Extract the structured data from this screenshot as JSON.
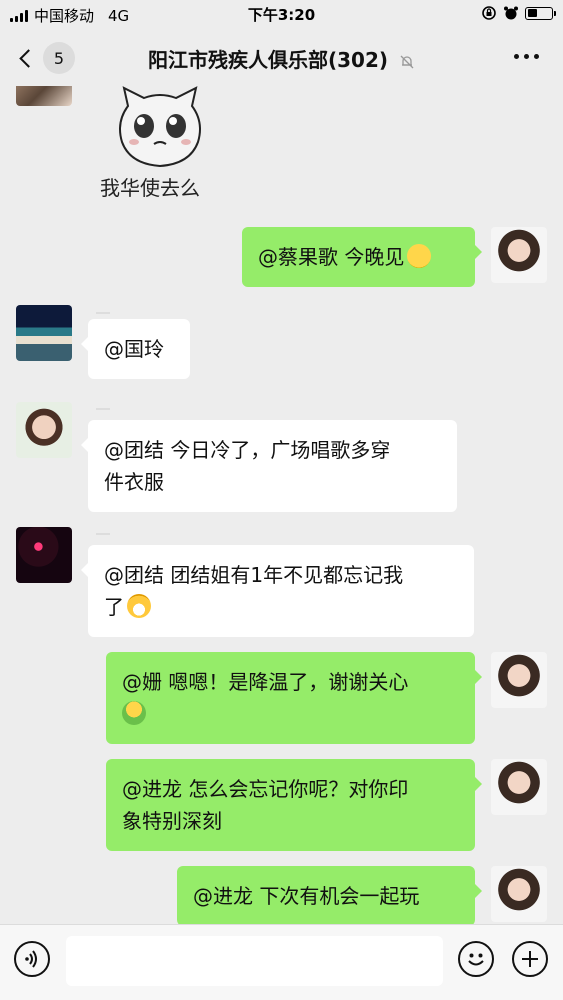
{
  "status_bar": {
    "carrier": "中国移动",
    "network": "4G",
    "time": "下午3:20"
  },
  "nav": {
    "back_count": "5",
    "title": "阳江市残疾人俱乐部(302)"
  },
  "sticker_caption": "我华使去么",
  "messages": [
    {
      "side": "out",
      "text": "@蔡果歌 今晚见"
    },
    {
      "side": "in",
      "text": "@国玲"
    },
    {
      "side": "in",
      "text_line1": "@团结 今日冷了，广场唱歌多穿",
      "text_line2": "件衣服"
    },
    {
      "side": "in",
      "text_line1": "@团结 团结姐有1年不见都忘记我",
      "text_line2": "了"
    },
    {
      "side": "out",
      "text_line1": "@姗 嗯嗯！是降温了，谢谢关心",
      "text_line2": ""
    },
    {
      "side": "out",
      "text_line1": "@进龙 怎么会忘记你呢？对你印",
      "text_line2": "象特别深刻"
    },
    {
      "side": "out",
      "text": "@进龙 下次有机会一起玩"
    }
  ],
  "input": {
    "placeholder": ""
  },
  "colors": {
    "outgoing_bubble": "#95ec69",
    "incoming_bubble": "#ffffff",
    "background": "#ededed"
  }
}
